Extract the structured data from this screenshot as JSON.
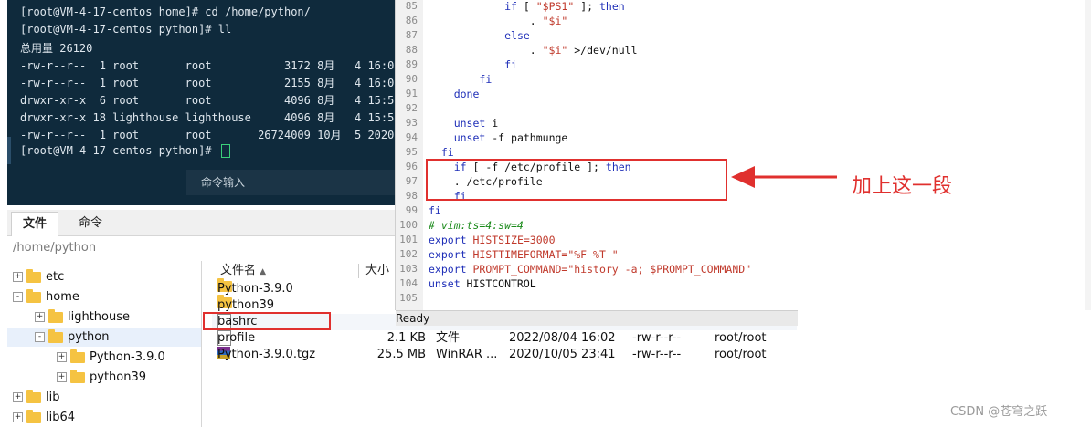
{
  "terminal": {
    "lines": [
      "[root@VM-4-17-centos home]# cd /home/python/",
      "[root@VM-4-17-centos python]# ll",
      "总用量 26120",
      "-rw-r--r--  1 root       root           3172 8月   4 16:06",
      "-rw-r--r--  1 root       root           2155 8月   4 16:02",
      "drwxr-xr-x  6 root       root           4096 8月   4 15:56",
      "drwxr-xr-x 18 lighthouse lighthouse     4096 8月   4 15:56",
      "-rw-r--r--  1 root       root       26724009 10月  5 2020",
      "[root@VM-4-17-centos python]# "
    ],
    "command_input_placeholder": "命令输入"
  },
  "tabs": [
    {
      "label": "文件",
      "active": true
    },
    {
      "label": "命令",
      "active": false
    }
  ],
  "path": "/home/python",
  "tree": [
    {
      "label": "etc",
      "expander": "+",
      "level": 0
    },
    {
      "label": "home",
      "expander": "-",
      "level": 0
    },
    {
      "label": "lighthouse",
      "expander": "+",
      "level": 1
    },
    {
      "label": "python",
      "expander": "-",
      "level": 1
    },
    {
      "label": "Python-3.9.0",
      "expander": "+",
      "level": 2
    },
    {
      "label": "python39",
      "expander": "+",
      "level": 2
    },
    {
      "label": "lib",
      "expander": "+",
      "level": 0
    },
    {
      "label": "lib64",
      "expander": "+",
      "level": 0
    }
  ],
  "file_list": {
    "columns": [
      "文件名",
      "大小"
    ],
    "rows": [
      {
        "name": "Python-3.9.0",
        "icon": "folder-icon",
        "size": "",
        "type": "",
        "modified": "",
        "perms": "",
        "owner": ""
      },
      {
        "name": "python39",
        "icon": "folder-icon",
        "size": "",
        "type": "",
        "modified": "",
        "perms": "",
        "owner": ""
      },
      {
        "name": "bashrc",
        "icon": "file-icon",
        "size": "",
        "type": "",
        "modified": "",
        "perms": "",
        "owner": ""
      },
      {
        "name": "profile",
        "icon": "file-icon",
        "size": "2.1 KB",
        "type": "文件",
        "modified": "2022/08/04 16:02",
        "perms": "-rw-r--r--",
        "owner": "root/root"
      },
      {
        "name": "Python-3.9.0.tgz",
        "icon": "rar-icon",
        "size": "25.5 MB",
        "type": "WinRAR ...",
        "modified": "2020/10/05 23:41",
        "perms": "-rw-r--r--",
        "owner": "root/root"
      }
    ]
  },
  "editor": {
    "line_numbers": [
      "85",
      "86",
      "87",
      "88",
      "89",
      "90",
      "91",
      "92",
      "93",
      "94",
      "95",
      "96",
      "97",
      "98",
      "99",
      "100",
      "101",
      "102",
      "103",
      "104",
      "105"
    ],
    "status": "Ready"
  },
  "annotation": {
    "note": "加上这一段"
  },
  "watermark": "CSDN @苍穹之跃",
  "colors": {
    "terminal_bg": "#0f2a3c",
    "annotation_red": "#e0302e",
    "keyword_blue": "#1f2fb8",
    "comment_green": "#1a8a1a"
  }
}
